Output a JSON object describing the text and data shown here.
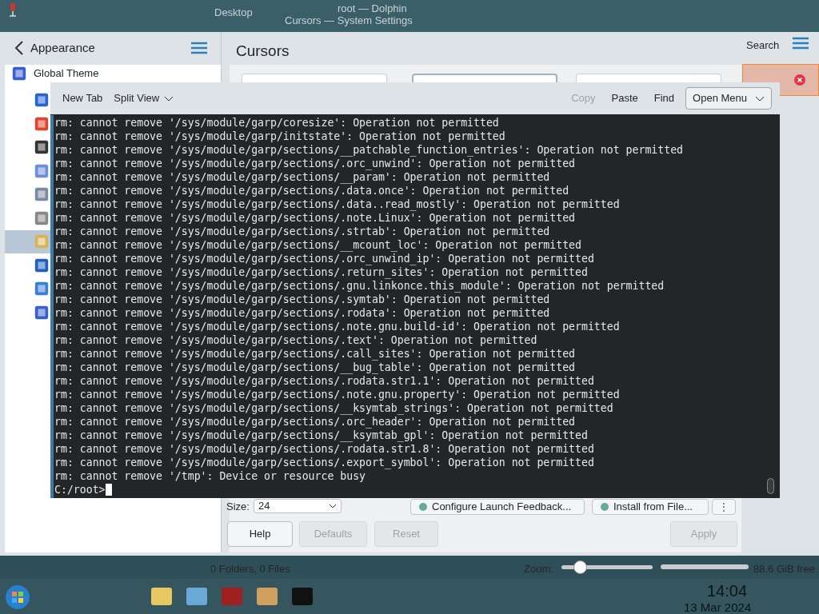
{
  "desktop_titles": [
    "Desktop",
    "root — Dolphin",
    "Cursors — System Settings"
  ],
  "settings": {
    "back_label": "Appearance",
    "page_title": "Cursors",
    "search_label": "Search",
    "sidebar_items": [
      {
        "label": "Global Theme",
        "selected": false
      },
      {
        "selected": false
      },
      {
        "selected": false
      },
      {
        "selected": false
      },
      {
        "selected": false
      },
      {
        "selected": false
      },
      {
        "selected": false
      },
      {
        "selected": true
      },
      {
        "selected": false
      },
      {
        "selected": false
      },
      {
        "selected": false
      }
    ],
    "size_label": "Size:",
    "size_value": "24",
    "actions": [
      "Configure Launch Feedback...",
      "Install from File..."
    ],
    "more_button": "⋮",
    "buttons": [
      {
        "label": "Help",
        "disabled": false
      },
      {
        "label": "Defaults",
        "disabled": true
      },
      {
        "label": "Reset",
        "disabled": true
      },
      {
        "label": "Apply",
        "disabled": true
      }
    ]
  },
  "konsole": {
    "toolbar": [
      {
        "label": "New Tab",
        "disabled": false
      },
      {
        "label": "Split View",
        "disabled": false
      }
    ],
    "toolbar_right": [
      {
        "label": "Copy",
        "disabled": true
      },
      {
        "label": "Paste",
        "disabled": false
      },
      {
        "label": "Find",
        "disabled": false
      }
    ],
    "menu_button": "Open Menu",
    "lines": [
      "rm: cannot remove '/sys/module/garp/coresize': Operation not permitted",
      "rm: cannot remove '/sys/module/garp/initstate': Operation not permitted",
      "rm: cannot remove '/sys/module/garp/sections/__patchable_function_entries': Operation not permitted",
      "rm: cannot remove '/sys/module/garp/sections/.orc_unwind': Operation not permitted",
      "rm: cannot remove '/sys/module/garp/sections/__param': Operation not permitted",
      "rm: cannot remove '/sys/module/garp/sections/.data.once': Operation not permitted",
      "rm: cannot remove '/sys/module/garp/sections/.data..read_mostly': Operation not permitted",
      "rm: cannot remove '/sys/module/garp/sections/.note.Linux': Operation not permitted",
      "rm: cannot remove '/sys/module/garp/sections/.strtab': Operation not permitted",
      "rm: cannot remove '/sys/module/garp/sections/__mcount_loc': Operation not permitted",
      "rm: cannot remove '/sys/module/garp/sections/.orc_unwind_ip': Operation not permitted",
      "rm: cannot remove '/sys/module/garp/sections/.return_sites': Operation not permitted",
      "rm: cannot remove '/sys/module/garp/sections/.gnu.linkonce.this_module': Operation not permitted",
      "rm: cannot remove '/sys/module/garp/sections/.symtab': Operation not permitted",
      "rm: cannot remove '/sys/module/garp/sections/.rodata': Operation not permitted",
      "rm: cannot remove '/sys/module/garp/sections/.note.gnu.build-id': Operation not permitted",
      "rm: cannot remove '/sys/module/garp/sections/.text': Operation not permitted",
      "rm: cannot remove '/sys/module/garp/sections/.call_sites': Operation not permitted",
      "rm: cannot remove '/sys/module/garp/sections/__bug_table': Operation not permitted",
      "rm: cannot remove '/sys/module/garp/sections/.rodata.str1.1': Operation not permitted",
      "rm: cannot remove '/sys/module/garp/sections/.note.gnu.property': Operation not permitted",
      "rm: cannot remove '/sys/module/garp/sections/__ksymtab_strings': Operation not permitted",
      "rm: cannot remove '/sys/module/garp/sections/.orc_header': Operation not permitted",
      "rm: cannot remove '/sys/module/garp/sections/__ksymtab_gpl': Operation not permitted",
      "rm: cannot remove '/sys/module/garp/sections/.rodata.str1.8': Operation not permitted",
      "rm: cannot remove '/sys/module/garp/sections/.export_symbol': Operation not permitted",
      "rm: cannot remove '/tmp': Device or resource busy"
    ],
    "prompt": "C:/root>"
  },
  "dolphin_status": {
    "summary": "0 Folders, 0 Files",
    "zoom_label": "Zoom:",
    "zoom_slider": {
      "level": 0.2
    },
    "free_space": "88.6 GiB free"
  },
  "taskbar": {
    "time": "14:04",
    "date": "13 Mar 2024"
  }
}
